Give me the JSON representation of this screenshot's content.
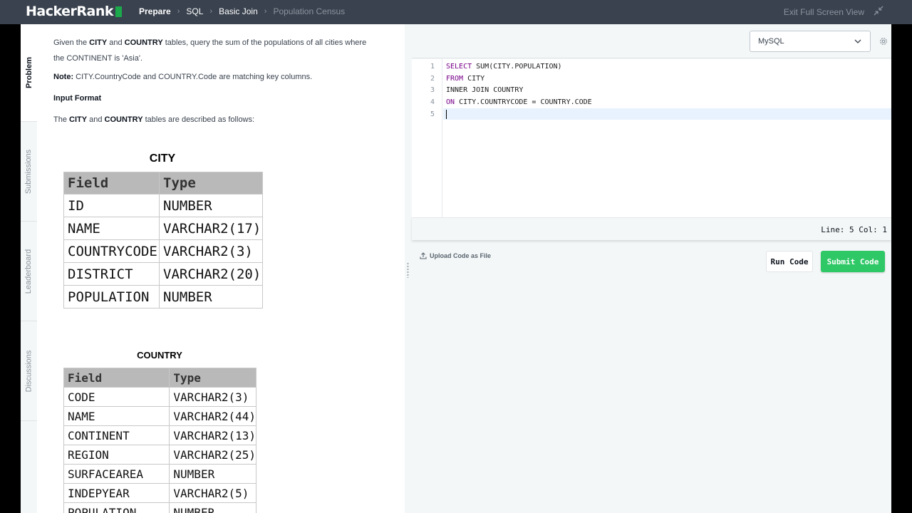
{
  "nav": {
    "logo": "HackerRank",
    "breadcrumbs": [
      "Prepare",
      "SQL",
      "Basic Join",
      "Population Census"
    ],
    "exit_label": "Exit Full Screen View"
  },
  "side_tabs": [
    "Problem",
    "Submissions",
    "Leaderboard",
    "Discussions"
  ],
  "problem": {
    "line1_pre": "Given the ",
    "line1_b1": "CITY",
    "line1_mid": " and ",
    "line1_b2": "COUNTRY",
    "line1_post": " tables, query the sum of the populations of all cities where",
    "line2": "the CONTINENT is 'Asia'.",
    "note_label": "Note:",
    "note_text": " CITY.CountryCode and COUNTRY.Code are matching key columns.",
    "input_format": "Input Format",
    "desc_pre": "The ",
    "desc_b1": "CITY",
    "desc_mid": " and ",
    "desc_b2": "COUNTRY",
    "desc_post": " tables are described as follows:"
  },
  "city_table": {
    "title": "CITY",
    "headers": [
      "Field",
      "Type"
    ],
    "rows": [
      [
        "ID",
        "NUMBER"
      ],
      [
        "NAME",
        "VARCHAR2(17)"
      ],
      [
        "COUNTRYCODE",
        "VARCHAR2(3)"
      ],
      [
        "DISTRICT",
        "VARCHAR2(20)"
      ],
      [
        "POPULATION",
        "NUMBER"
      ]
    ]
  },
  "country_table": {
    "title": "COUNTRY",
    "headers": [
      "Field",
      "Type"
    ],
    "rows": [
      [
        "CODE",
        "VARCHAR2(3)"
      ],
      [
        "NAME",
        "VARCHAR2(44)"
      ],
      [
        "CONTINENT",
        "VARCHAR2(13)"
      ],
      [
        "REGION",
        "VARCHAR2(25)"
      ],
      [
        "SURFACEAREA",
        "NUMBER"
      ],
      [
        "INDEPYEAR",
        "VARCHAR2(5)"
      ],
      [
        "POPULATION",
        "NUMBER"
      ]
    ]
  },
  "editor": {
    "language": "MySQL",
    "line_numbers": [
      "1",
      "2",
      "3",
      "4",
      "5"
    ],
    "lines": [
      {
        "kw": "SELECT",
        "rest": " SUM(CITY.POPULATION)"
      },
      {
        "kw": "FROM",
        "rest": " CITY"
      },
      {
        "kw": "",
        "rest": "INNER JOIN COUNTRY"
      },
      {
        "kw": "ON",
        "rest": " CITY.COUNTRYCODE = COUNTRY.CODE"
      },
      {
        "kw": "",
        "rest": ""
      }
    ],
    "status": "Line: 5 Col: 1"
  },
  "actions": {
    "upload_label": "Upload Code as File",
    "run_label": "Run Code",
    "submit_label": "Submit Code"
  },
  "colors": {
    "nav_bg": "#39424e",
    "brand_green": "#1ba94c",
    "submit_green": "#2ec866",
    "keyword": "#770088"
  }
}
